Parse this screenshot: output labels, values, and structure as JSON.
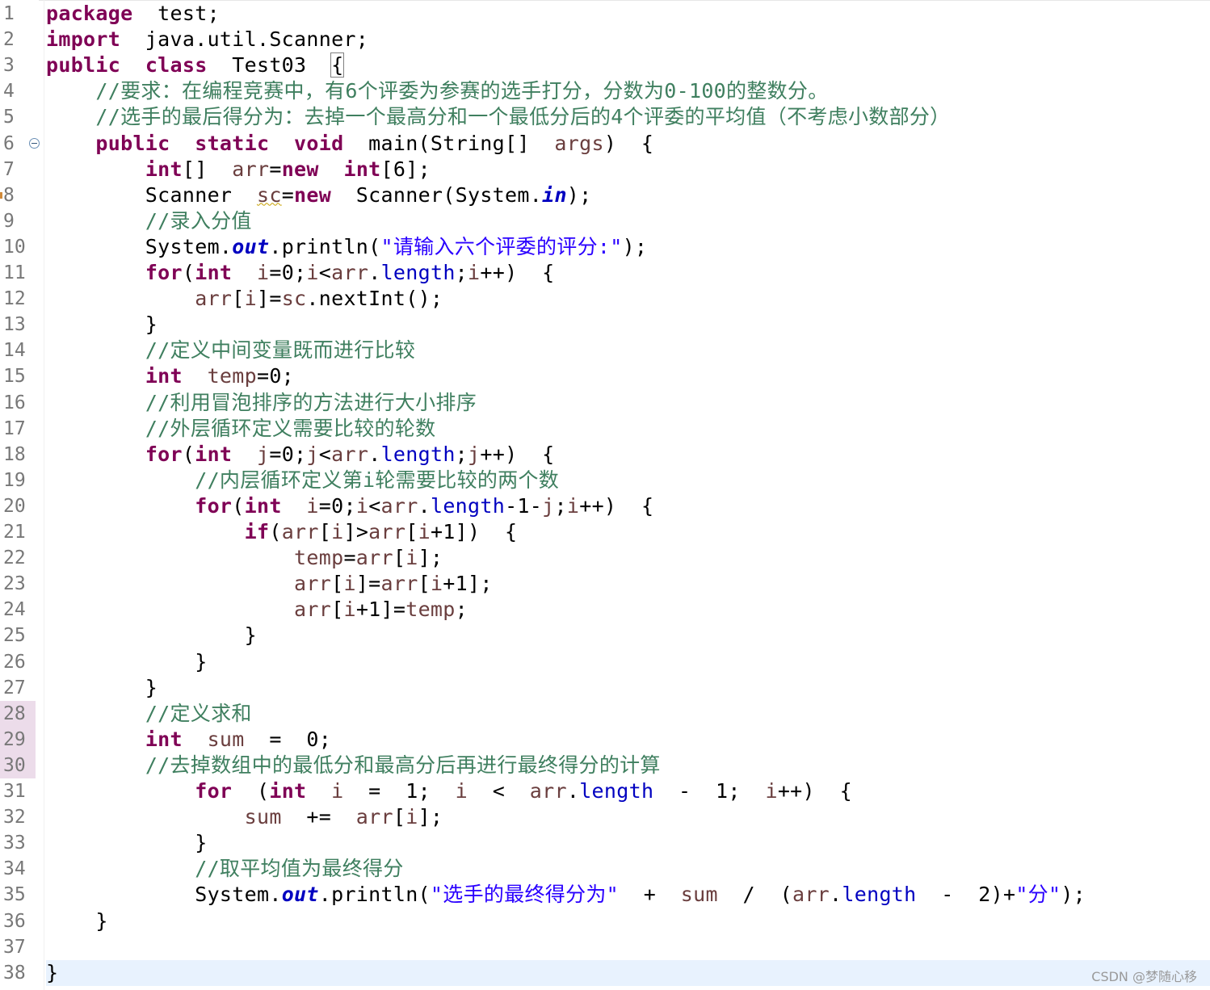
{
  "editor": {
    "lines": [
      {
        "n": "1",
        "tokens": [
          [
            "kw",
            "package"
          ],
          [
            "",
            "  test;"
          ]
        ]
      },
      {
        "n": "2",
        "tokens": [
          [
            "kw",
            "import"
          ],
          [
            "",
            "  java.util.Scanner;"
          ]
        ]
      },
      {
        "n": "3",
        "tokens": [
          [
            "kw",
            "public"
          ],
          [
            "",
            "  "
          ],
          [
            "kw",
            "class"
          ],
          [
            "",
            "  Test03  "
          ],
          [
            "br",
            "{"
          ]
        ]
      },
      {
        "n": "4",
        "tokens": [
          [
            "",
            "    "
          ],
          [
            "cm",
            "//要求：在编程竞赛中，有6个评委为参赛的选手打分，分数为0-100的整数分。"
          ]
        ]
      },
      {
        "n": "5",
        "tokens": [
          [
            "",
            "    "
          ],
          [
            "cm",
            "//选手的最后得分为：去掉一个最高分和一个最低分后的4个评委的平均值（不考虑小数部分）"
          ]
        ]
      },
      {
        "n": "6",
        "fold": true,
        "tokens": [
          [
            "",
            "    "
          ],
          [
            "kw",
            "public"
          ],
          [
            "",
            "  "
          ],
          [
            "kw",
            "static"
          ],
          [
            "",
            "  "
          ],
          [
            "kw",
            "void"
          ],
          [
            "",
            "  main(String[]  "
          ],
          [
            "var",
            "args"
          ],
          [
            "",
            ")  {"
          ]
        ]
      },
      {
        "n": "7",
        "tokens": [
          [
            "",
            "        "
          ],
          [
            "kw",
            "int"
          ],
          [
            "",
            "[]  "
          ],
          [
            "var",
            "arr"
          ],
          [
            "",
            "="
          ],
          [
            "kw",
            "new"
          ],
          [
            "",
            "  "
          ],
          [
            "kw",
            "int"
          ],
          [
            "",
            "[6];"
          ]
        ]
      },
      {
        "n": "8",
        "marker": true,
        "tokens": [
          [
            "",
            "        Scanner  "
          ],
          [
            "sq",
            "sc"
          ],
          [
            "",
            "="
          ],
          [
            "kw",
            "new"
          ],
          [
            "",
            "  Scanner(System."
          ],
          [
            "sfld",
            "in"
          ],
          [
            "",
            ");"
          ]
        ]
      },
      {
        "n": "9",
        "tokens": [
          [
            "",
            "        "
          ],
          [
            "cm",
            "//录入分值"
          ]
        ]
      },
      {
        "n": "10",
        "tokens": [
          [
            "",
            "        System."
          ],
          [
            "sfld",
            "out"
          ],
          [
            "",
            ".println("
          ],
          [
            "str",
            "\"请输入六个评委的评分:\""
          ],
          [
            "",
            ");"
          ]
        ]
      },
      {
        "n": "11",
        "tokens": [
          [
            "",
            "        "
          ],
          [
            "kw",
            "for"
          ],
          [
            "",
            "("
          ],
          [
            "kw",
            "int"
          ],
          [
            "",
            "  "
          ],
          [
            "var",
            "i"
          ],
          [
            "",
            "=0;"
          ],
          [
            "var",
            "i"
          ],
          [
            "",
            "<"
          ],
          [
            "var",
            "arr"
          ],
          [
            "",
            "."
          ],
          [
            "fld",
            "length"
          ],
          [
            "",
            ";"
          ],
          [
            "var",
            "i"
          ],
          [
            "",
            "++)  {"
          ]
        ]
      },
      {
        "n": "12",
        "tokens": [
          [
            "",
            "            "
          ],
          [
            "var",
            "arr"
          ],
          [
            "",
            "["
          ],
          [
            "var",
            "i"
          ],
          [
            "",
            "]="
          ],
          [
            "var",
            "sc"
          ],
          [
            "",
            ".nextInt();"
          ]
        ]
      },
      {
        "n": "13",
        "tokens": [
          [
            "",
            "        }"
          ]
        ]
      },
      {
        "n": "14",
        "tokens": [
          [
            "",
            "        "
          ],
          [
            "cm",
            "//定义中间变量既而进行比较"
          ]
        ]
      },
      {
        "n": "15",
        "tokens": [
          [
            "",
            "        "
          ],
          [
            "kw",
            "int"
          ],
          [
            "",
            "  "
          ],
          [
            "var",
            "temp"
          ],
          [
            "",
            "=0;"
          ]
        ]
      },
      {
        "n": "16",
        "tokens": [
          [
            "",
            "        "
          ],
          [
            "cm",
            "//利用冒泡排序的方法进行大小排序"
          ]
        ]
      },
      {
        "n": "17",
        "tokens": [
          [
            "",
            "        "
          ],
          [
            "cm",
            "//外层循环定义需要比较的轮数"
          ]
        ]
      },
      {
        "n": "18",
        "tokens": [
          [
            "",
            "        "
          ],
          [
            "kw",
            "for"
          ],
          [
            "",
            "("
          ],
          [
            "kw",
            "int"
          ],
          [
            "",
            "  "
          ],
          [
            "var",
            "j"
          ],
          [
            "",
            "=0;"
          ],
          [
            "var",
            "j"
          ],
          [
            "",
            "<"
          ],
          [
            "var",
            "arr"
          ],
          [
            "",
            "."
          ],
          [
            "fld",
            "length"
          ],
          [
            "",
            ";"
          ],
          [
            "var",
            "j"
          ],
          [
            "",
            "++)  {"
          ]
        ]
      },
      {
        "n": "19",
        "tokens": [
          [
            "",
            "            "
          ],
          [
            "cm",
            "//内层循环定义第i轮需要比较的两个数"
          ]
        ]
      },
      {
        "n": "20",
        "tokens": [
          [
            "",
            "            "
          ],
          [
            "kw",
            "for"
          ],
          [
            "",
            "("
          ],
          [
            "kw",
            "int"
          ],
          [
            "",
            "  "
          ],
          [
            "var",
            "i"
          ],
          [
            "",
            "=0;"
          ],
          [
            "var",
            "i"
          ],
          [
            "",
            "<"
          ],
          [
            "var",
            "arr"
          ],
          [
            "",
            "."
          ],
          [
            "fld",
            "length"
          ],
          [
            "",
            "-1-"
          ],
          [
            "var",
            "j"
          ],
          [
            "",
            ";"
          ],
          [
            "var",
            "i"
          ],
          [
            "",
            "++)  {"
          ]
        ]
      },
      {
        "n": "21",
        "tokens": [
          [
            "",
            "                "
          ],
          [
            "kw",
            "if"
          ],
          [
            "",
            "("
          ],
          [
            "var",
            "arr"
          ],
          [
            "",
            "["
          ],
          [
            "var",
            "i"
          ],
          [
            "",
            "]>"
          ],
          [
            "var",
            "arr"
          ],
          [
            "",
            "["
          ],
          [
            "var",
            "i"
          ],
          [
            "",
            "+1])  {"
          ]
        ]
      },
      {
        "n": "22",
        "tokens": [
          [
            "",
            "                    "
          ],
          [
            "var",
            "temp"
          ],
          [
            "",
            "="
          ],
          [
            "var",
            "arr"
          ],
          [
            "",
            "["
          ],
          [
            "var",
            "i"
          ],
          [
            "",
            "];"
          ]
        ]
      },
      {
        "n": "23",
        "tokens": [
          [
            "",
            "                    "
          ],
          [
            "var",
            "arr"
          ],
          [
            "",
            "["
          ],
          [
            "var",
            "i"
          ],
          [
            "",
            "]="
          ],
          [
            "var",
            "arr"
          ],
          [
            "",
            "["
          ],
          [
            "var",
            "i"
          ],
          [
            "",
            "+1];"
          ]
        ]
      },
      {
        "n": "24",
        "tokens": [
          [
            "",
            "                    "
          ],
          [
            "var",
            "arr"
          ],
          [
            "",
            "["
          ],
          [
            "var",
            "i"
          ],
          [
            "",
            "+1]="
          ],
          [
            "var",
            "temp"
          ],
          [
            "",
            ";"
          ]
        ]
      },
      {
        "n": "25",
        "tokens": [
          [
            "",
            "                }"
          ]
        ]
      },
      {
        "n": "26",
        "tokens": [
          [
            "",
            "            }"
          ]
        ]
      },
      {
        "n": "27",
        "tokens": [
          [
            "",
            "        }"
          ]
        ]
      },
      {
        "n": "28",
        "marked": true,
        "tokens": [
          [
            "",
            "        "
          ],
          [
            "cm",
            "//定义求和"
          ]
        ]
      },
      {
        "n": "29",
        "marked": true,
        "tokens": [
          [
            "",
            "        "
          ],
          [
            "kw",
            "int"
          ],
          [
            "",
            "  "
          ],
          [
            "var",
            "sum"
          ],
          [
            "",
            "  =  0;"
          ]
        ]
      },
      {
        "n": "30",
        "marked": true,
        "tokens": [
          [
            "",
            "        "
          ],
          [
            "cm",
            "//去掉数组中的最低分和最高分后再进行最终得分的计算"
          ]
        ]
      },
      {
        "n": "31",
        "tokens": [
          [
            "",
            "            "
          ],
          [
            "kw",
            "for"
          ],
          [
            "",
            "  ("
          ],
          [
            "kw",
            "int"
          ],
          [
            "",
            "  "
          ],
          [
            "var",
            "i"
          ],
          [
            "",
            "  =  1;  "
          ],
          [
            "var",
            "i"
          ],
          [
            "",
            "  <  "
          ],
          [
            "var",
            "arr"
          ],
          [
            "",
            "."
          ],
          [
            "fld",
            "length"
          ],
          [
            "",
            "  -  1;  "
          ],
          [
            "var",
            "i"
          ],
          [
            "",
            "++)  {"
          ]
        ]
      },
      {
        "n": "32",
        "tokens": [
          [
            "",
            "                "
          ],
          [
            "var",
            "sum"
          ],
          [
            "",
            "  +=  "
          ],
          [
            "var",
            "arr"
          ],
          [
            "",
            "["
          ],
          [
            "var",
            "i"
          ],
          [
            "",
            "];"
          ]
        ]
      },
      {
        "n": "33",
        "tokens": [
          [
            "",
            "            }"
          ]
        ]
      },
      {
        "n": "34",
        "tokens": [
          [
            "",
            "            "
          ],
          [
            "cm",
            "//取平均值为最终得分"
          ]
        ]
      },
      {
        "n": "35",
        "tokens": [
          [
            "",
            "            System."
          ],
          [
            "sfld",
            "out"
          ],
          [
            "",
            ".println("
          ],
          [
            "str",
            "\"选手的最终得分为\""
          ],
          [
            "",
            "  +  "
          ],
          [
            "var",
            "sum"
          ],
          [
            "",
            "  /  ("
          ],
          [
            "var",
            "arr"
          ],
          [
            "",
            "."
          ],
          [
            "fld",
            "length"
          ],
          [
            "",
            "  -  2)+"
          ],
          [
            "str",
            "\"分\""
          ],
          [
            "",
            ");"
          ]
        ]
      },
      {
        "n": "36",
        "tokens": [
          [
            "",
            "    }"
          ]
        ]
      },
      {
        "n": "37",
        "tokens": [
          [
            "",
            ""
          ]
        ]
      },
      {
        "n": "38",
        "current": true,
        "tokens": [
          [
            "",
            "}"
          ]
        ]
      }
    ]
  },
  "watermark": "CSDN @梦随心移"
}
